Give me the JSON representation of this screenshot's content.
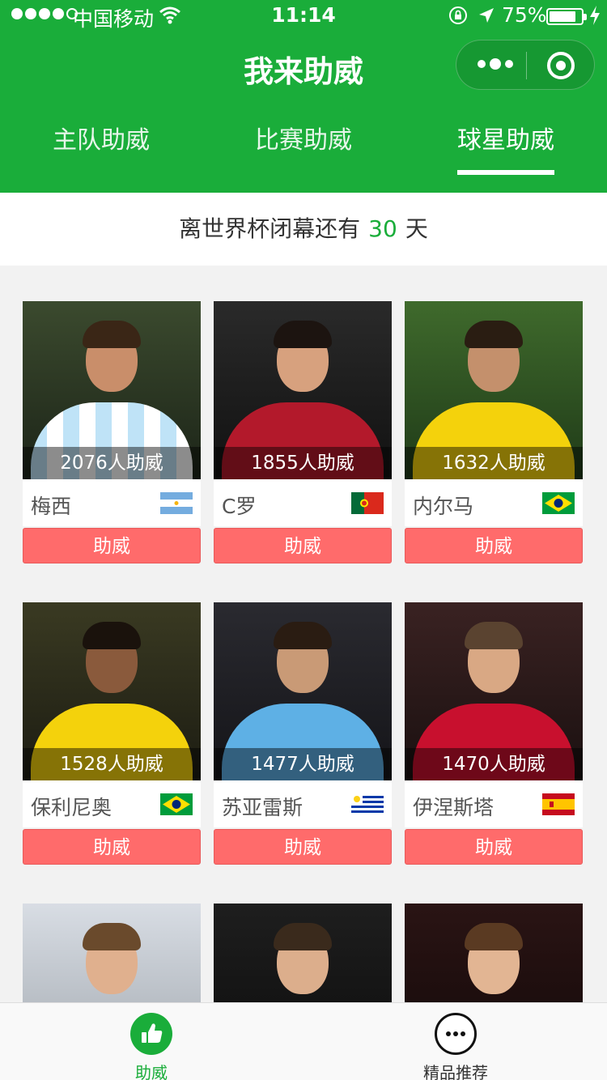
{
  "status_bar": {
    "carrier": "中国移动",
    "time": "11:14",
    "battery": "75%",
    "battery_level": 0.75
  },
  "nav": {
    "title": "我来助威"
  },
  "tabs": [
    {
      "label": "主队助威",
      "active": false
    },
    {
      "label": "比赛助威",
      "active": false
    },
    {
      "label": "球星助威",
      "active": true
    }
  ],
  "countdown": {
    "prefix": "离世界杯闭幕还有",
    "days": "30",
    "suffix": "天"
  },
  "players": [
    {
      "name": "梅西",
      "count": "2076人助威",
      "button": "助威",
      "flag": "argentina-flag"
    },
    {
      "name": "C罗",
      "count": "1855人助威",
      "button": "助威",
      "flag": "portugal-flag"
    },
    {
      "name": "内尔马",
      "count": "1632人助威",
      "button": "助威",
      "flag": "brazil-flag"
    },
    {
      "name": "保利尼奥",
      "count": "1528人助威",
      "button": "助威",
      "flag": "brazil-flag"
    },
    {
      "name": "苏亚雷斯",
      "count": "1477人助威",
      "button": "助威",
      "flag": "uruguay-flag"
    },
    {
      "name": "伊涅斯塔",
      "count": "1470人助威",
      "button": "助威",
      "flag": "spain-flag"
    },
    {
      "name": "",
      "count": "",
      "button": "",
      "flag": ""
    },
    {
      "name": "",
      "count": "",
      "button": "",
      "flag": ""
    },
    {
      "name": "",
      "count": "",
      "button": "",
      "flag": ""
    }
  ],
  "tabbar": [
    {
      "label": "助威",
      "icon": "thumbs-up-icon",
      "active": true
    },
    {
      "label": "精品推荐",
      "icon": "more-dots-icon",
      "active": false
    }
  ],
  "colors": {
    "brand_green": "#1aad3a",
    "button_red": "#ff6b6b",
    "countdown_number": "#1aad3a"
  }
}
